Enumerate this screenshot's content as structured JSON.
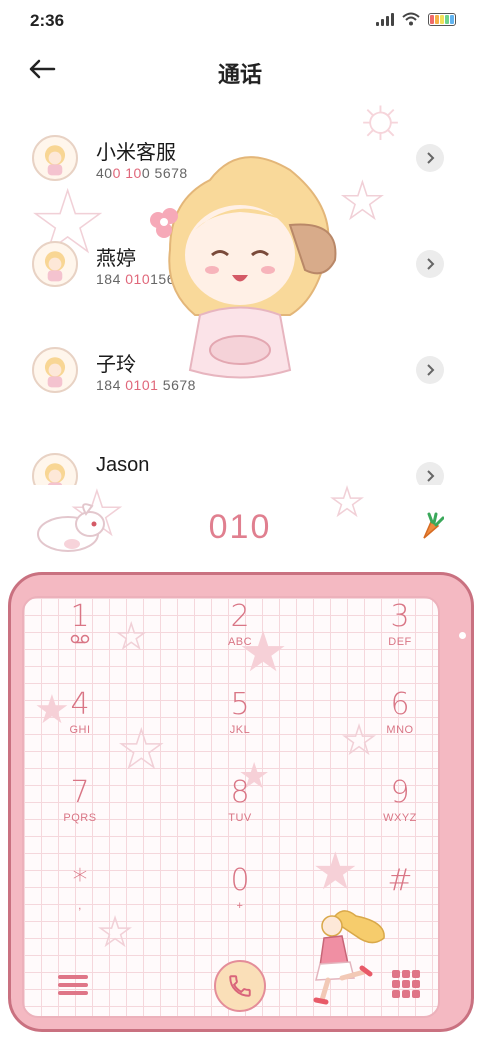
{
  "status_bar": {
    "time": "2:36"
  },
  "header": {
    "title": "通话"
  },
  "contacts": [
    {
      "name": "小米客服",
      "number_parts": [
        "40",
        "0",
        " ",
        "10",
        "0",
        " 5678"
      ]
    },
    {
      "name": "燕婷",
      "number_parts": [
        "184 ",
        "010",
        "1",
        "5689"
      ]
    },
    {
      "name": "子玲",
      "number_parts": [
        "184 ",
        "0101",
        " 5678"
      ]
    },
    {
      "name": "Jason",
      "number_parts": [
        "",
        "",
        ""
      ]
    }
  ],
  "dialer": {
    "display": "010",
    "keys": [
      {
        "digit": "1",
        "letters": ""
      },
      {
        "digit": "2",
        "letters": "ABC"
      },
      {
        "digit": "3",
        "letters": "DEF"
      },
      {
        "digit": "4",
        "letters": "GHI"
      },
      {
        "digit": "5",
        "letters": "JKL"
      },
      {
        "digit": "6",
        "letters": "MNO"
      },
      {
        "digit": "7",
        "letters": "PQRS"
      },
      {
        "digit": "8",
        "letters": "TUV"
      },
      {
        "digit": "9",
        "letters": "WXYZ"
      },
      {
        "digit": "*",
        "letters": ","
      },
      {
        "digit": "0",
        "letters": "+"
      },
      {
        "digit": "#",
        "letters": ""
      }
    ]
  },
  "icons": {
    "back": "arrow-left-icon",
    "detail": "chevron-right-icon",
    "voicemail": "voicemail-icon",
    "call": "phone-icon",
    "menu": "menu-icon",
    "dialpad": "dialpad-icon",
    "carrot": "carrot-icon"
  },
  "colors": {
    "accent": "#d97585",
    "highlight": "#e0677a",
    "frame": "#f4b9c2"
  }
}
